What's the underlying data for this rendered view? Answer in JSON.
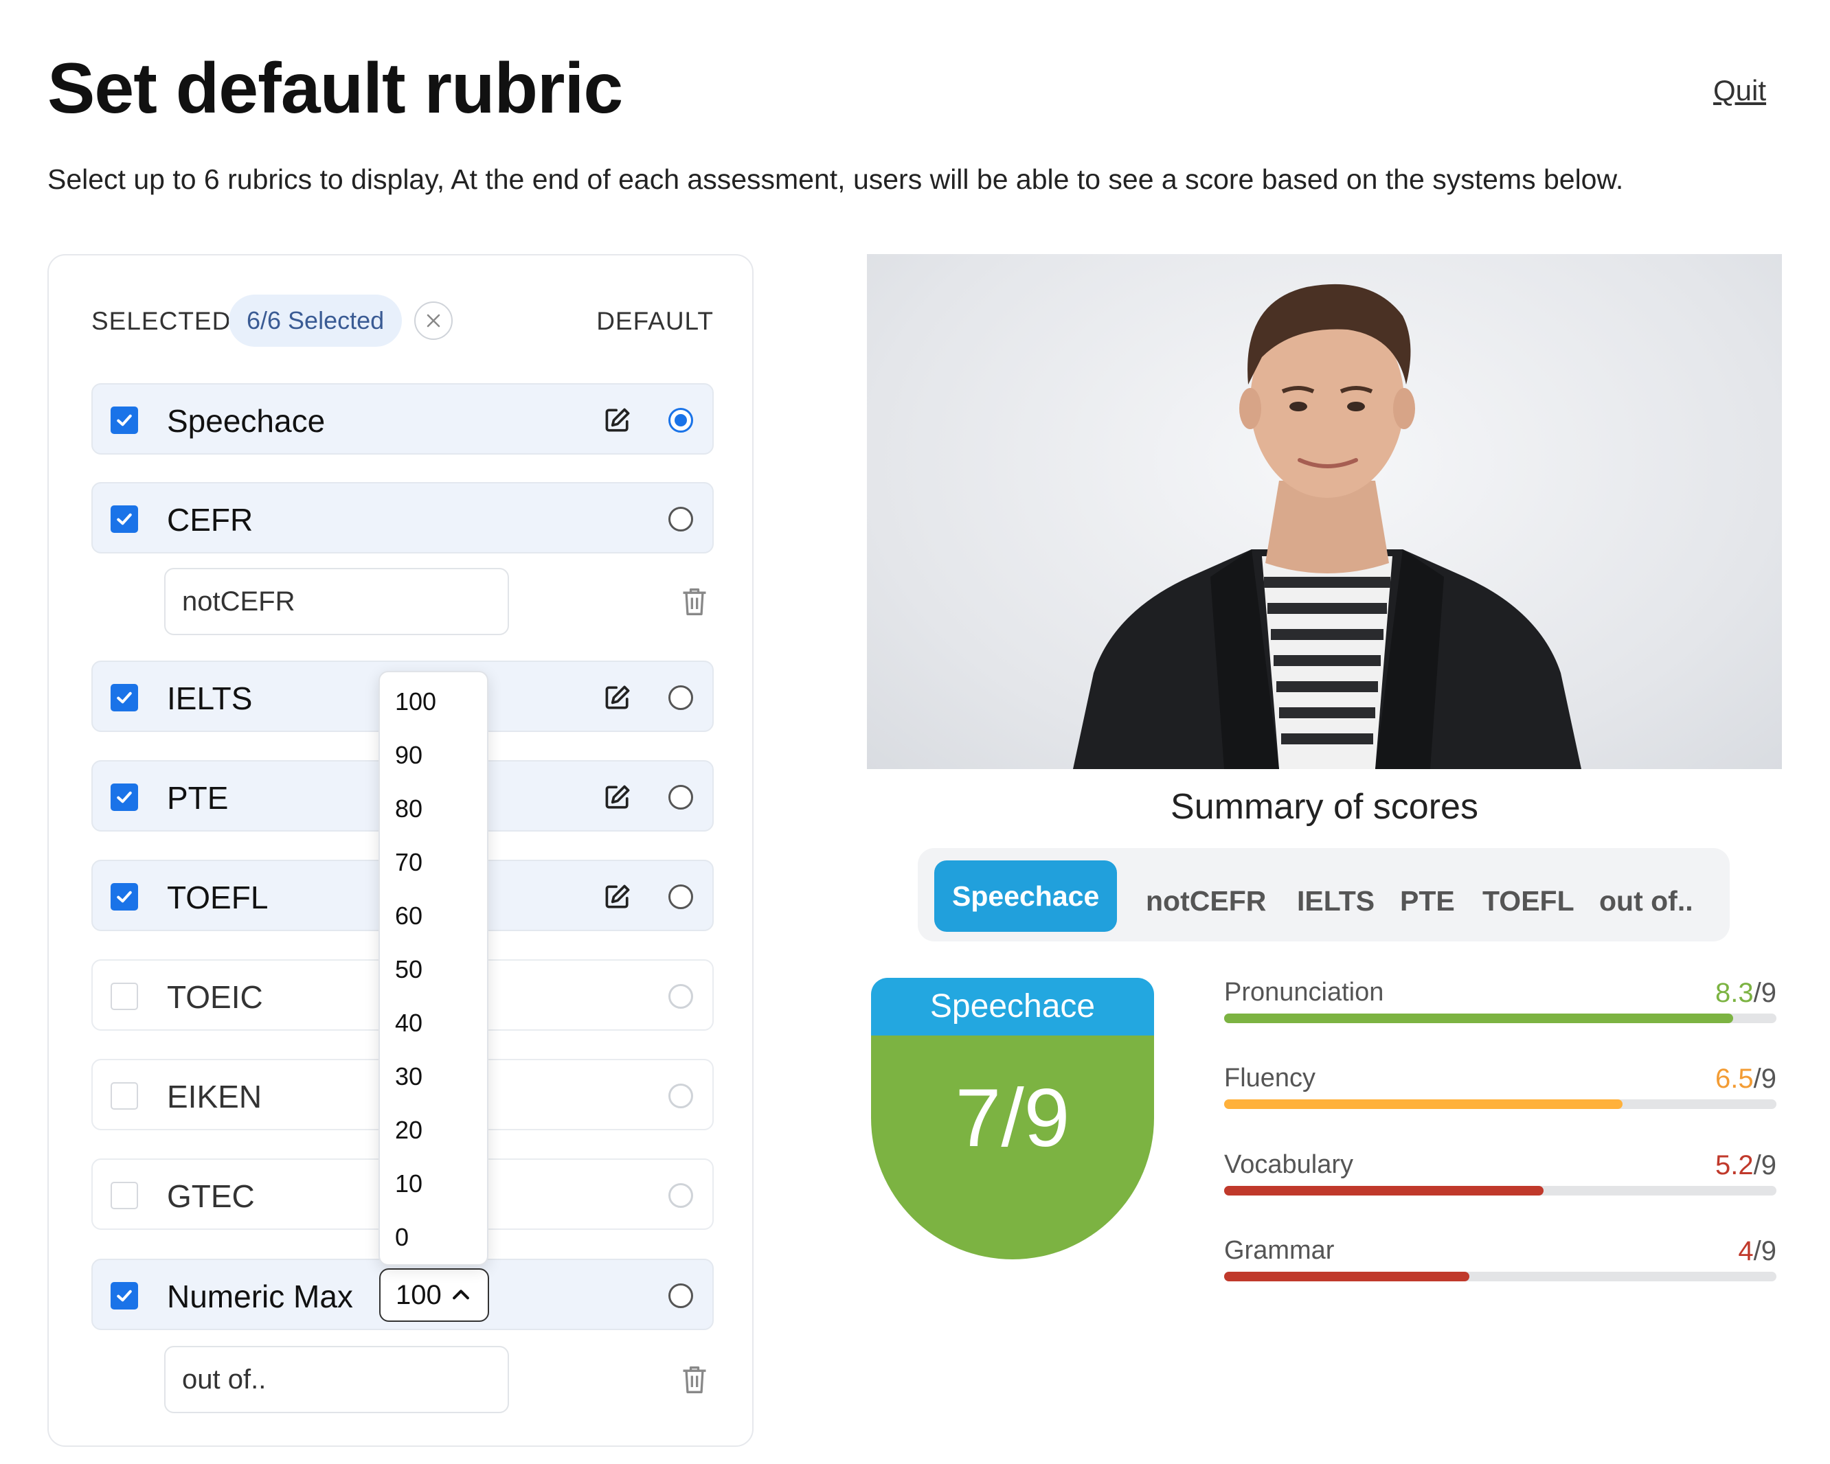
{
  "header": {
    "title": "Set default rubric",
    "quit_label": "Quit",
    "subtitle": "Select up to 6 rubrics to display, At the end of each assessment, users will be able to see a score based on the systems below."
  },
  "panel": {
    "selected_label": "SELECTED",
    "selected_badge": "6/6 Selected",
    "default_label": "DEFAULT",
    "rubrics": [
      {
        "label": "Speechace",
        "checked": true,
        "default": true
      },
      {
        "label": "CEFR",
        "checked": true,
        "default": false,
        "alias": "notCEFR"
      },
      {
        "label": "IELTS",
        "checked": true,
        "default": false
      },
      {
        "label": "PTE",
        "checked": true,
        "default": false
      },
      {
        "label": "TOEFL",
        "checked": true,
        "default": false
      },
      {
        "label": "TOEIC",
        "checked": false,
        "default": false
      },
      {
        "label": "EIKEN",
        "checked": false,
        "default": false
      },
      {
        "label": "GTEC",
        "checked": false,
        "default": false
      },
      {
        "label": "Numeric Max",
        "checked": true,
        "default": false,
        "max_value": "100",
        "alias": "out of.."
      }
    ],
    "max_options": [
      "100",
      "90",
      "80",
      "70",
      "60",
      "50",
      "40",
      "30",
      "20",
      "10",
      "0"
    ]
  },
  "summary": {
    "title": "Summary of scores",
    "tabs": [
      "Speechace",
      "notCEFR",
      "IELTS",
      "PTE",
      "TOEFL",
      "out of.."
    ],
    "active_tab": "Speechace",
    "card": {
      "header": "Speechace",
      "score": "7/9",
      "header_color": "#23a7e0",
      "body_color": "#7cb342"
    },
    "metrics": [
      {
        "name": "Pronunciation",
        "value": "8.3",
        "max": "/9",
        "fraction": 0.922,
        "color": "#7cb342"
      },
      {
        "name": "Fluency",
        "value": "6.5",
        "max": "/9",
        "fraction": 0.722,
        "color": "#ffb13b"
      },
      {
        "name": "Vocabulary",
        "value": "5.2",
        "max": "/9",
        "fraction": 0.578,
        "color": "#c0392b"
      },
      {
        "name": "Grammar",
        "value": "4",
        "max": "/9",
        "fraction": 0.444,
        "color": "#c0392b"
      }
    ]
  },
  "colors": {
    "accent": "#1a73e8",
    "tab_active": "#21a0dc"
  }
}
